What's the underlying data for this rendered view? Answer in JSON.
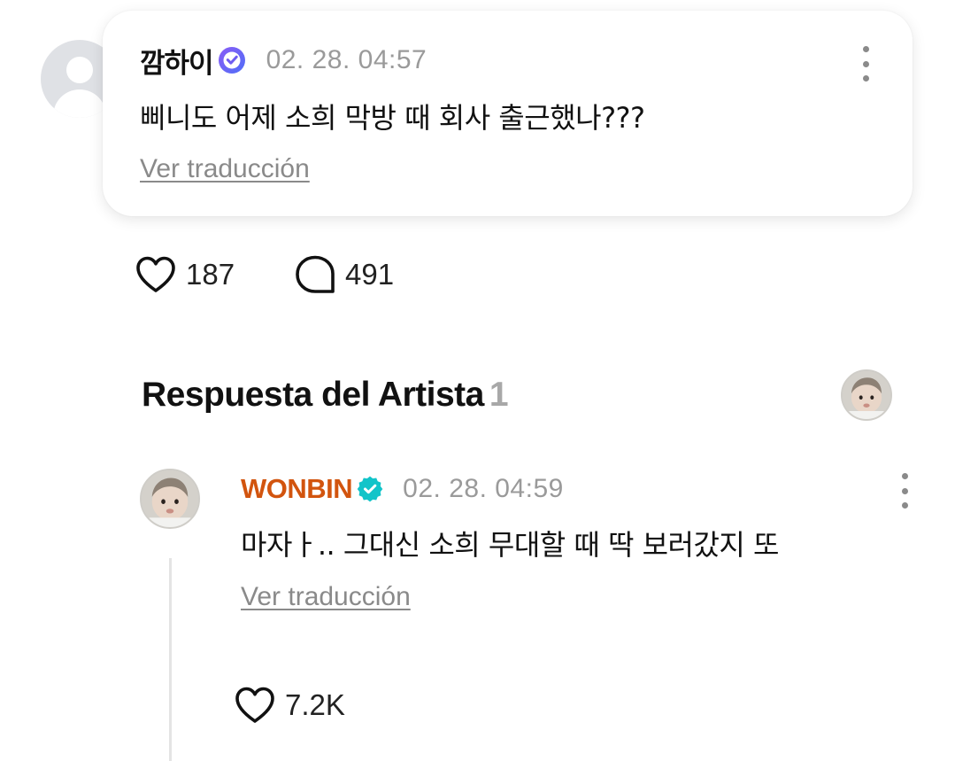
{
  "comment": {
    "username": "깜하이",
    "timestamp": "02. 28. 04:57",
    "text": "삐니도 어제 소희 막방 때 회사 출근했나???",
    "translate_label": "Ver traducción",
    "likes": "187",
    "replies": "491"
  },
  "artist_section": {
    "title": "Respuesta del Artista",
    "count": "1"
  },
  "reply": {
    "artist_name": "WONBIN",
    "timestamp": "02. 28. 04:59",
    "text": "마자ㅏ..  그대신 소희 무대할 때 딱 보러갔지 또",
    "translate_label": "Ver traducción",
    "likes": "7.2K"
  },
  "colors": {
    "artist_name": "#d2540e",
    "verified_badge_user": "#6e5cf0",
    "verified_badge_artist": "#12c4c9",
    "muted_text": "#9a9a9a"
  },
  "icons": {
    "user_badge": "verified-heart-badge-icon",
    "artist_badge": "verified-check-badge-icon",
    "like": "heart-outline-icon",
    "reply": "speech-bubble-outline-icon",
    "more": "kebab-menu-icon"
  }
}
